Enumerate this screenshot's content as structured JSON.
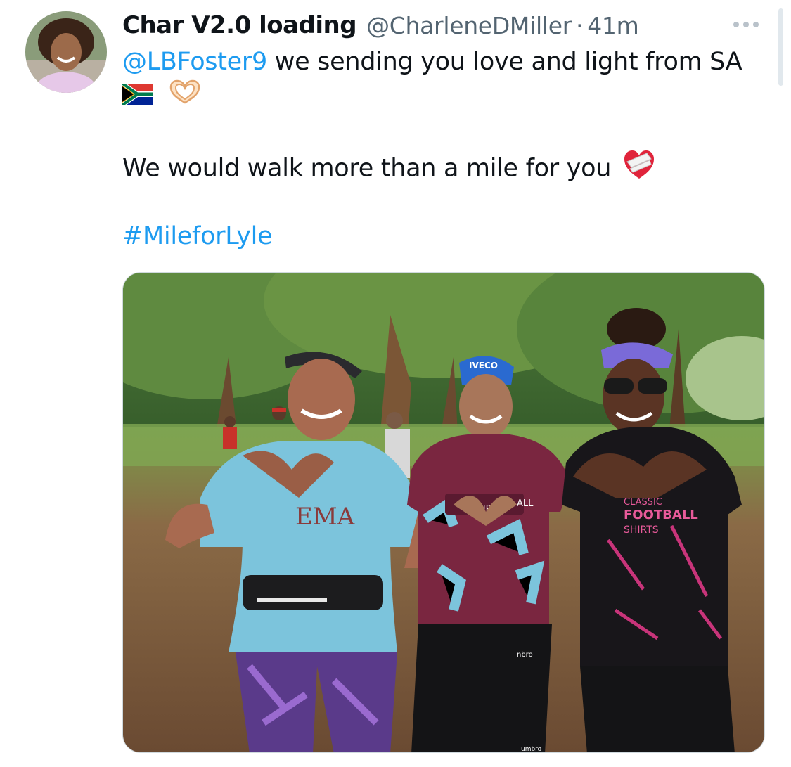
{
  "tweet": {
    "author": {
      "display_name": "Char V2.0 loading",
      "handle": "@CharleneDMiller",
      "separator": "·",
      "time": "41m"
    },
    "text": {
      "mention": "@LBFoster9",
      "line1_rest": " we sending you love and light from SA",
      "line3": "We would walk more than a mile for you",
      "hashtag": "#MileforLyle"
    },
    "emojis": {
      "flag": "south-africa-flag",
      "hands": "heart-hands",
      "heart": "mending-heart"
    },
    "photo": {
      "shirt_texts": [
        "EMA",
        "HIRTS",
        "ALL",
        "CLASSIC",
        "FOOTBALL",
        "SHIRTS",
        "IVECO",
        "umbro",
        "nbro"
      ]
    },
    "colors": {
      "link": "#1d9bf0",
      "text": "#0f1419",
      "muted": "#536471"
    }
  }
}
